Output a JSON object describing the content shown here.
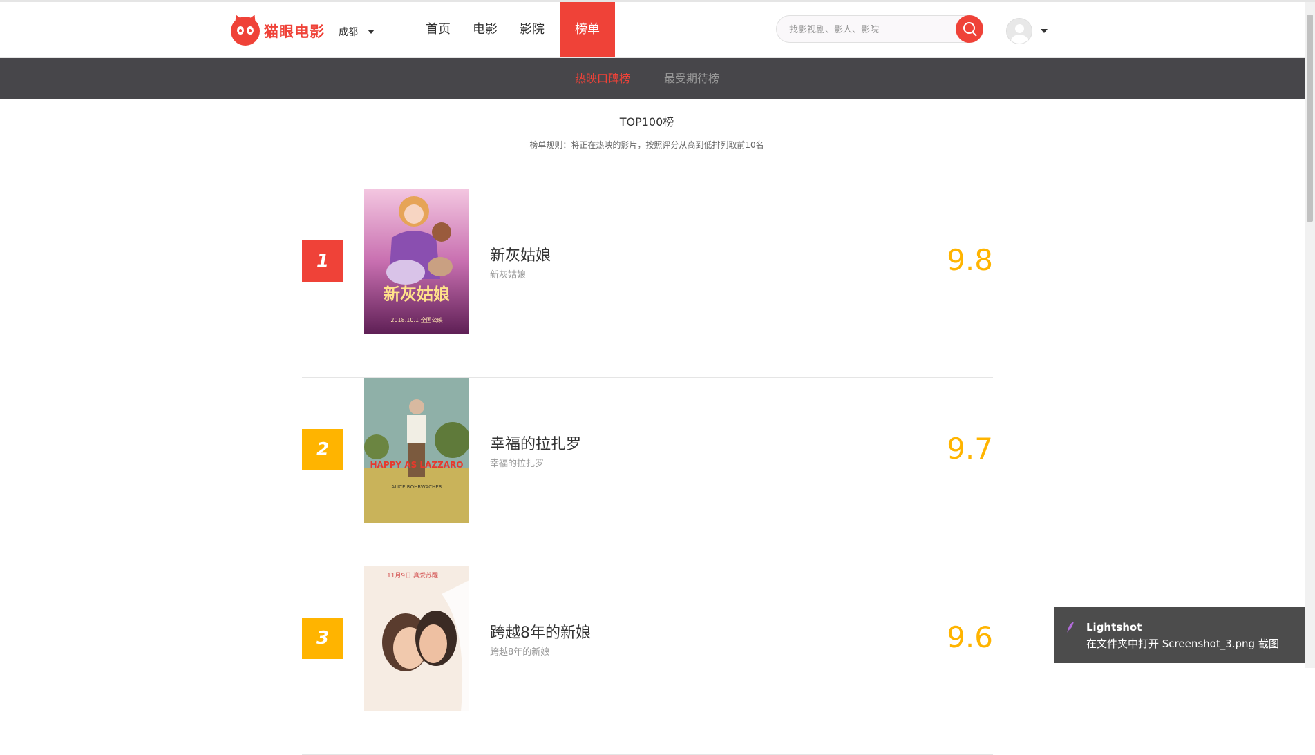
{
  "brand": {
    "logo_text": "猫眼电影",
    "color": "#ef4238"
  },
  "city": {
    "selected": "成都"
  },
  "nav": {
    "items": [
      {
        "label": "首页",
        "active": false
      },
      {
        "label": "电影",
        "active": false
      },
      {
        "label": "影院",
        "active": false
      },
      {
        "label": "榜单",
        "active": true
      }
    ]
  },
  "search": {
    "placeholder": "找影视剧、影人、影院",
    "value": ""
  },
  "subnav": {
    "items": [
      {
        "label": "热映口碑榜",
        "active": true
      },
      {
        "label": "最受期待榜",
        "active": false
      }
    ]
  },
  "board": {
    "title": "TOP100榜",
    "rule": "榜单规则：将正在热映的影片，按照评分从高到低排列取前10名",
    "movies": [
      {
        "rank": "1",
        "name": "新灰姑娘",
        "sub": "新灰姑娘",
        "score": "9.8",
        "rank_color": "#ef4238",
        "poster_text": "新灰姑娘",
        "poster_date": "2018.10.1 全国公映"
      },
      {
        "rank": "2",
        "name": "幸福的拉扎罗",
        "sub": "幸福的拉扎罗",
        "score": "9.7",
        "rank_color": "#ffb400",
        "poster_text": "HAPPY AS LAZZARO",
        "poster_credit": "ALICE ROHRWACHER"
      },
      {
        "rank": "3",
        "name": "跨越8年的新娘",
        "sub": "跨越8年的新娘",
        "score": "9.6",
        "rank_color": "#ffb400",
        "poster_text": "11月9日 真爱苏醒"
      }
    ]
  },
  "toast": {
    "app": "Lightshot",
    "message": "在文件夹中打开 Screenshot_3.png 截图"
  },
  "icons": {
    "search": "search-icon",
    "dropdown": "chevron-down-icon",
    "avatar": "user-avatar-icon",
    "toast": "feather-icon"
  }
}
